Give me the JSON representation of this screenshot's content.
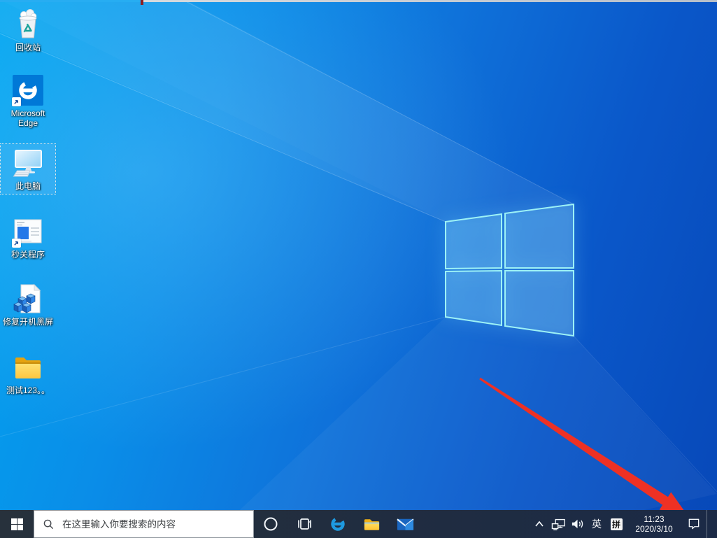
{
  "desktop": {
    "icons": [
      {
        "label": "回收站",
        "icon": "recycle-bin-icon",
        "selected": false,
        "shortcut": false
      },
      {
        "label": "Microsoft Edge",
        "icon": "edge-icon",
        "selected": false,
        "shortcut": true
      },
      {
        "label": "此电脑",
        "icon": "this-pc-icon",
        "selected": true,
        "shortcut": false
      },
      {
        "label": "秒关程序",
        "icon": "app-window-icon",
        "selected": false,
        "shortcut": true
      },
      {
        "label": "修复开机黑屏",
        "icon": "registry-file-icon",
        "selected": false,
        "shortcut": false
      },
      {
        "label": "测试123。。",
        "icon": "folder-icon",
        "selected": false,
        "shortcut": false
      }
    ]
  },
  "taskbar": {
    "buttons": [
      "start",
      "search",
      "cortana",
      "task-view",
      "edge",
      "file-explorer",
      "mail"
    ],
    "search": {
      "placeholder": "在这里输入你要搜索的内容"
    },
    "tray": {
      "hidden_icons": "chevron-up",
      "language_indicator": "英",
      "ime_indicator": "拼",
      "time": "11:23",
      "date": "2020/3/10"
    }
  },
  "annotation": {
    "arrow_color": "#ee3124",
    "top_tick_color": "#8d1d20"
  },
  "colors": {
    "taskbar_bg": "#212d3f",
    "wallpaper_top_left": "#00a6f0",
    "wallpaper_bottom_right": "#0748b8",
    "logo_stroke": "#9df2f6",
    "search_box_bg": "#ffffff",
    "edge_blue": "#0078d7",
    "folder_yellow": "#fdc640"
  }
}
